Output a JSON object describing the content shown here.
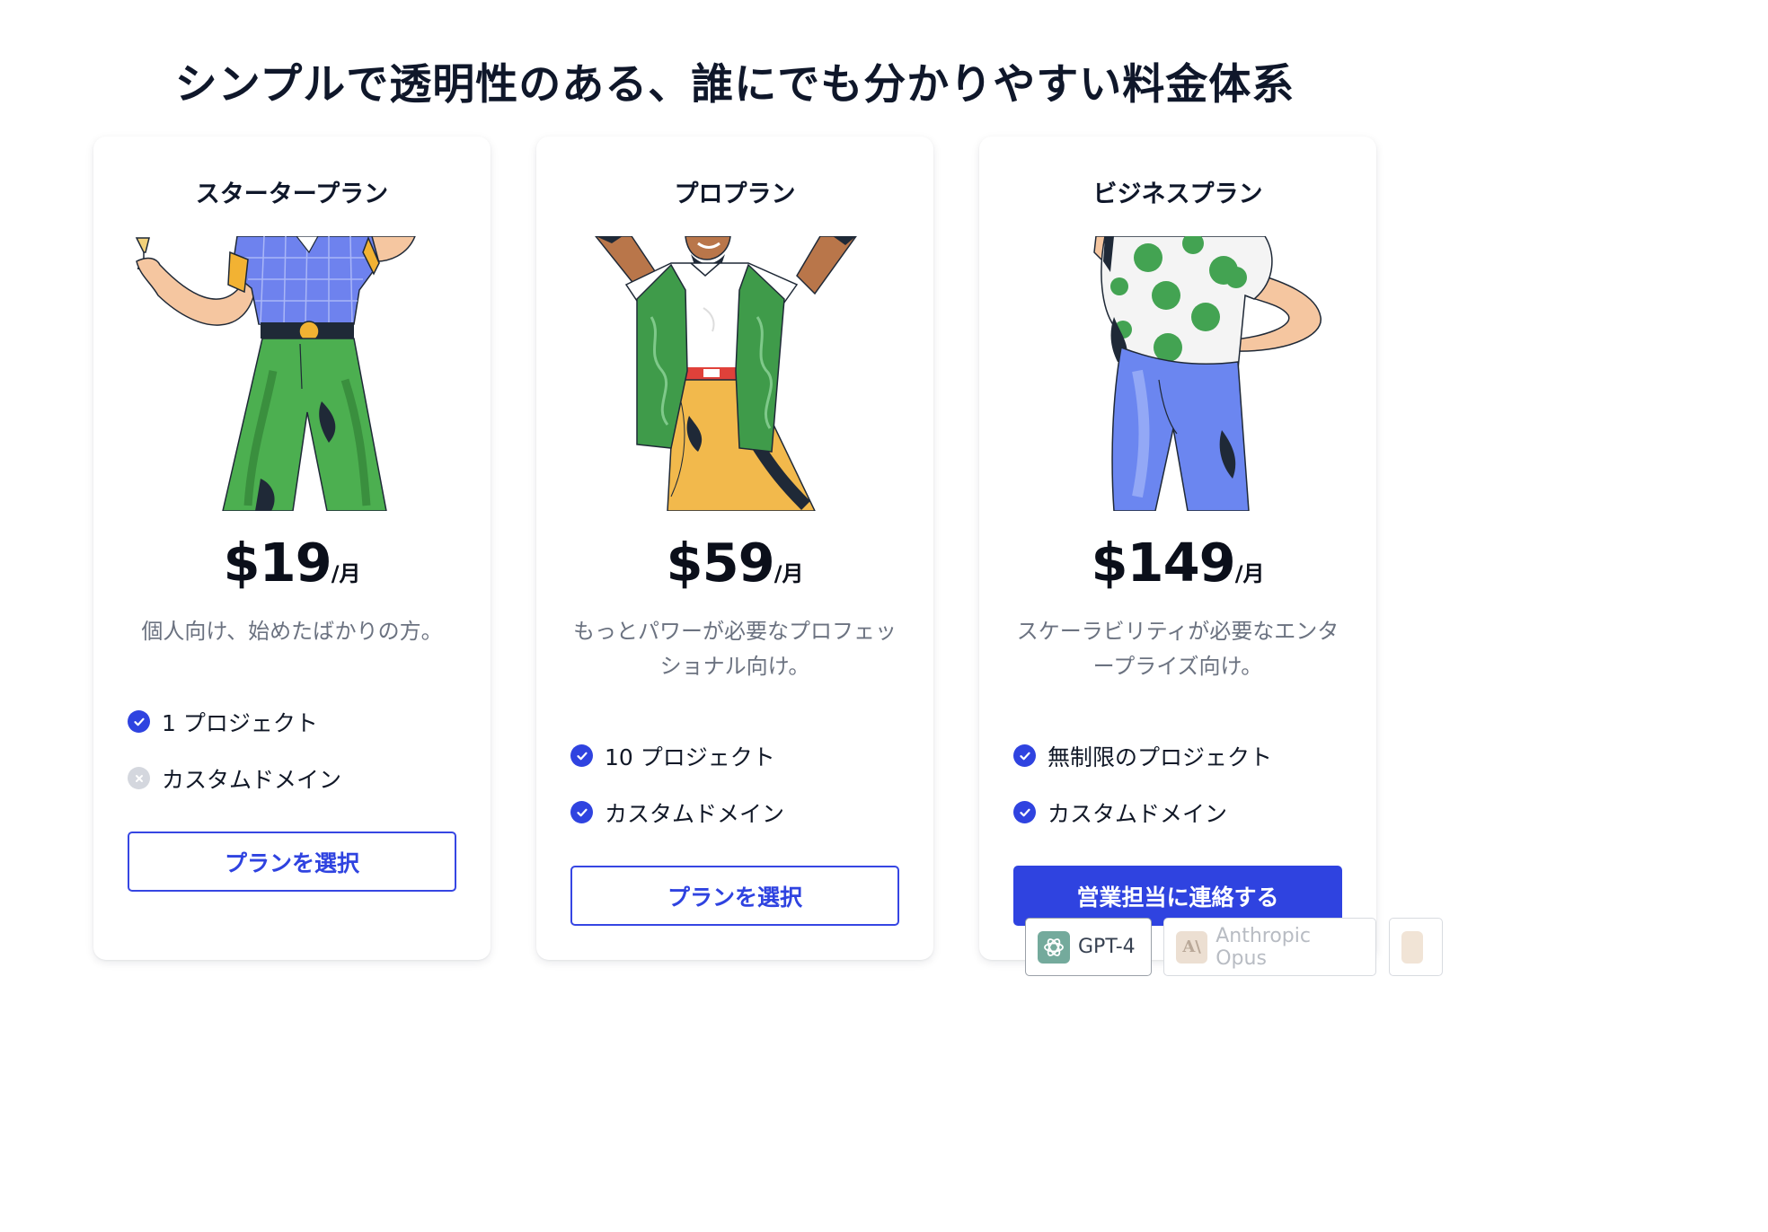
{
  "heading": "シンプルで透明性のある、誰にでも分かりやすい料金体系",
  "plans": [
    {
      "name": "スタータープラン",
      "price": "$19",
      "unit": "/月",
      "description": "個人向け、始めたばかりの方。",
      "features": [
        {
          "label": "1 プロジェクト",
          "included": true,
          "icon": "check-icon"
        },
        {
          "label": "カスタムドメイン",
          "included": false,
          "icon": "cross-icon"
        }
      ],
      "button": "プランを選択"
    },
    {
      "name": "プロプラン",
      "price": "$59",
      "unit": "/月",
      "description": "もっとパワーが必要なプロフェッショナル向け。",
      "features": [
        {
          "label": "10 プロジェクト",
          "included": true,
          "icon": "check-icon"
        },
        {
          "label": "カスタムドメイン",
          "included": true,
          "icon": "check-icon"
        }
      ],
      "button": "プランを選択"
    },
    {
      "name": "ビジネスプラン",
      "price": "$149",
      "unit": "/月",
      "description": "スケーラビリティが必要なエンタープライズ向け。",
      "features": [
        {
          "label": "無制限のプロジェクト",
          "included": true,
          "icon": "check-icon"
        },
        {
          "label": "カスタムドメイン",
          "included": true,
          "icon": "check-icon"
        }
      ],
      "button": "営業担当に連絡する"
    }
  ],
  "model_chips": [
    {
      "label": "GPT-4",
      "icon": "openai-logo-icon"
    },
    {
      "label": "Anthropic Opus",
      "icon": "anthropic-logo-icon",
      "icon_text": "A\\"
    },
    {
      "label": "",
      "icon": "model-logo-icon"
    }
  ],
  "colors": {
    "accent": "#2f43e0",
    "heading": "#0f172a",
    "muted_text": "#6b7280",
    "disabled_icon": "#d4d7de"
  }
}
